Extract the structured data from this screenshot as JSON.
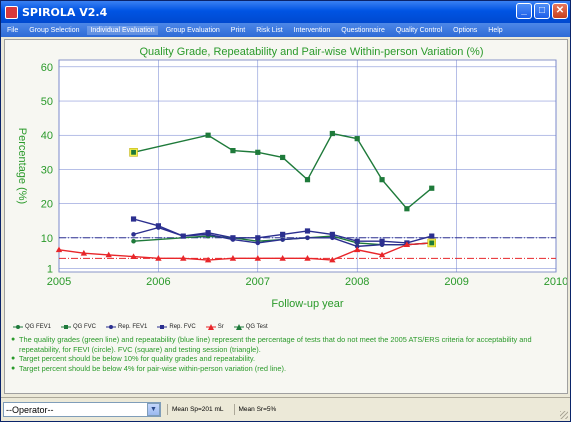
{
  "window": {
    "title": "SPIROLA V2.4"
  },
  "menu": [
    "File",
    "Group Selection",
    "Individual Evaluation",
    "Group Evaluation",
    "Print",
    "Risk List",
    "Intervention",
    "Questionnaire",
    "Quality Control",
    "Options",
    "Help"
  ],
  "active_menu": "Individual Evaluation",
  "colors": {
    "qg": "#1e7a3a",
    "rep": "#2b2f8f",
    "sr": "#e8262a",
    "title_green": "#2a9a2a",
    "grid": "#6d7fcf"
  },
  "chart_data": {
    "type": "line",
    "title": "Quality Grade, Repeatability and Pair-wise Within-person Variation (%)",
    "xlabel": "Follow-up year",
    "ylabel": "Percentage (%)",
    "xlim": [
      2005,
      2010
    ],
    "ylim": [
      0,
      62
    ],
    "x_ticks": [
      "2005",
      "2006",
      "2007",
      "2008",
      "2009",
      "2010"
    ],
    "y_ticks": [
      "1",
      "10",
      "20",
      "30",
      "40",
      "50",
      "60"
    ],
    "y_tick_values": [
      1,
      10,
      20,
      30,
      40,
      50,
      60
    ],
    "reference_lines": [
      {
        "name": "10% target",
        "y": 10,
        "color": "#2b2f8f",
        "style": "dash-dot"
      },
      {
        "name": "4% target",
        "y": 4,
        "color": "#e8262a",
        "style": "dash-dot"
      }
    ],
    "series": [
      {
        "name": "QG FEV1",
        "color": "#1e7a3a",
        "marker": "circle",
        "x": [
          2005.75,
          2006.5,
          2006.75,
          2007.0,
          2007.25,
          2007.5,
          2007.75,
          2008.0,
          2008.25,
          2008.5,
          2008.75
        ],
        "values": [
          9,
          10.5,
          10,
          9,
          9.5,
          10,
          10.5,
          8.5,
          8,
          8,
          8.5
        ]
      },
      {
        "name": "QG FVC",
        "color": "#1e7a3a",
        "marker": "square",
        "x": [
          2005.75,
          2006.5,
          2006.75,
          2007.0,
          2007.25,
          2007.5,
          2007.75,
          2008.0,
          2008.25,
          2008.5,
          2008.75
        ],
        "values": [
          35,
          40,
          35.5,
          35,
          33.5,
          27,
          40.5,
          39,
          27,
          18.5,
          24.5
        ]
      },
      {
        "name": "Rep. FEV1",
        "color": "#2b2f8f",
        "marker": "circle",
        "x": [
          2005.75,
          2006.0,
          2006.25,
          2006.5,
          2006.75,
          2007.0,
          2007.25,
          2007.5,
          2007.75,
          2008.0,
          2008.25,
          2008.5,
          2008.75
        ],
        "values": [
          11,
          13,
          10.5,
          11,
          9.5,
          8.5,
          9.5,
          10,
          10,
          7.5,
          8,
          8,
          8.5
        ]
      },
      {
        "name": "Rep. FVC",
        "color": "#2b2f8f",
        "marker": "square",
        "x": [
          2005.75,
          2006.0,
          2006.25,
          2006.5,
          2006.75,
          2007.0,
          2007.25,
          2007.5,
          2007.75,
          2008.0,
          2008.25,
          2008.5,
          2008.75
        ],
        "values": [
          15.5,
          13.5,
          10.5,
          11.5,
          10,
          10,
          11,
          12,
          11,
          9,
          9,
          8.5,
          10.5
        ]
      },
      {
        "name": "Sr",
        "color": "#e8262a",
        "marker": "triangle",
        "x": [
          2005.0,
          2005.25,
          2005.5,
          2005.75,
          2006.0,
          2006.25,
          2006.5,
          2006.75,
          2007.0,
          2007.25,
          2007.5,
          2007.75,
          2008.0,
          2008.25,
          2008.5,
          2008.75
        ],
        "values": [
          6.5,
          5.5,
          5,
          4.5,
          4,
          4,
          3.5,
          4,
          4,
          4,
          4,
          3.5,
          6.5,
          5,
          8,
          8.5
        ]
      },
      {
        "name": "QG Test",
        "color": "#1e7a3a",
        "marker": "triangle",
        "x": [],
        "values": []
      }
    ],
    "highlight_points": [
      {
        "x": 2005.75,
        "y": 35
      },
      {
        "x": 2008.75,
        "y": 8.5
      }
    ],
    "legend_position": "bottom-left",
    "grid": true
  },
  "legend": [
    "QG FEV1",
    "QG FVC",
    "Rep. FEV1",
    "Rep. FVC",
    "Sr",
    "QG Test"
  ],
  "notes": [
    "The quality grades (green line) and repeatability (blue line) represent the percentage of tests that do not meet the 2005 ATS/ERS criteria for acceptability and repeatability, for FEVI (circle). FVC (square) and testing session (triangle).",
    "Target percent should be below 10% for quality grades and repeatability.",
    "Target percent should be below 4% for pair-wise within-person variation (red line)."
  ],
  "statusbar": {
    "operator": "--Operator--",
    "mean_sp": "Mean Sp=201 mL",
    "mean_sr": "Mean Sr=5%"
  }
}
